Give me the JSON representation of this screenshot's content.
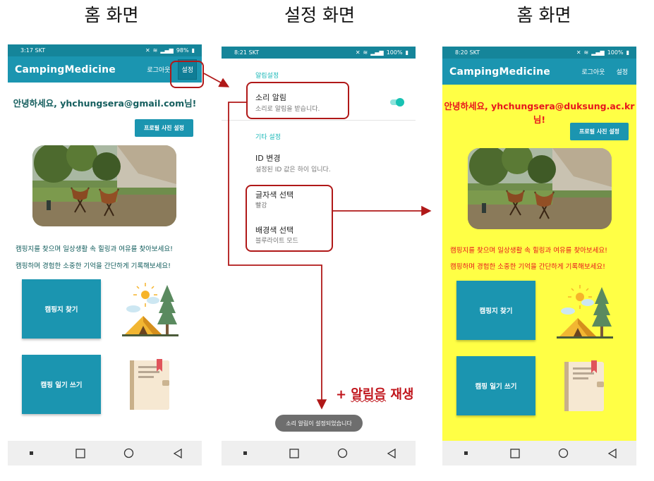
{
  "titles": {
    "left": "홈 화면",
    "middle": "설정 화면",
    "right": "홈 화면"
  },
  "left_phone": {
    "status_time": "3:17 SKT",
    "status_battery": "98%",
    "app_title": "CampingMedicine",
    "logout_label": "로그아웃",
    "settings_label": "설정",
    "greeting": "안녕하세요, yhchungsera@gmail.com님!",
    "profile_button": "프로필 사진 설정",
    "message_1": "캠핑지를 찾으며 일상생활 속 힐링과 여유를 찾아보세요!",
    "message_2": "캠핑하며 경험한 소중한 기억을 간단하게 기록해보세요!",
    "find_camp_button": "캠핑지 찾기",
    "write_diary_button": "캠핑 일기 쓰기",
    "text_color": "#155e5e",
    "background_color": "#ffffff"
  },
  "middle_phone": {
    "status_time": "8:21 SKT",
    "status_battery": "100%",
    "category_alarm": "알림설정",
    "sound_alarm_title": "소리 알림",
    "sound_alarm_summary": "소리로 알림을 받습니다.",
    "sound_alarm_on": true,
    "category_other": "기타 설정",
    "id_change_title": "ID 변경",
    "id_change_summary": "설정된 ID 값은 하이 입니다.",
    "text_color_title": "글자색 선택",
    "text_color_summary": "빨강",
    "bg_color_title": "배경색 선택",
    "bg_color_summary": "블루라이트 모드",
    "toast": "소리 알림이 설정되었습니다"
  },
  "right_phone": {
    "status_time": "8:20 SKT",
    "status_battery": "100%",
    "app_title": "CampingMedicine",
    "logout_label": "로그아웃",
    "settings_label": "설정",
    "greeting": "안녕하세요, yhchungsera@duksung.ac.kr님!",
    "profile_button": "프로필 사진 설정",
    "message_1": "캠핑지를 찾으며 일상생활 속 힐링과 여유를 찾아보세요!",
    "message_2": "캠핑하며 경험한 소중한 기억을 간단하게 기록해보세요!",
    "find_camp_button": "캠핑지 찾기",
    "write_diary_button": "캠핑 일기 쓰기",
    "text_color": "#e8161d",
    "background_color": "#ffff45"
  },
  "annotations": {
    "sound_note_prefix": "+ ",
    "sound_note_word": "알림음",
    "sound_note_suffix": " 재생",
    "color": "#b01818"
  },
  "icons": [
    "camera-icon",
    "wifi-icon",
    "signal-icon",
    "battery-icon",
    "mute-icon",
    "tent-illustration",
    "diary-illustration",
    "nav-recents-icon",
    "nav-home-icon",
    "nav-back-icon"
  ]
}
